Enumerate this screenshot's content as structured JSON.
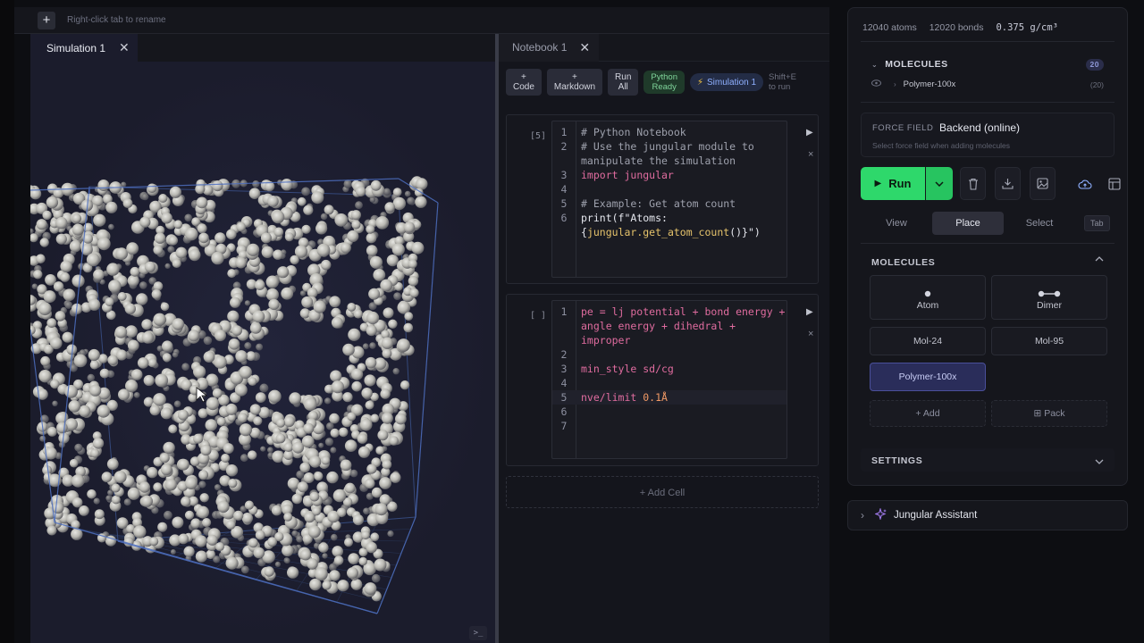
{
  "topbar": {
    "new_tab_label": "+",
    "hint": "Right-click tab to rename"
  },
  "simulation": {
    "tab_label": "Simulation 1",
    "close_glyph": "✕",
    "terminal_glyph": ">_"
  },
  "notebook": {
    "tab_label": "Notebook 1",
    "close_glyph": "✕",
    "toolbar": {
      "code_label": [
        "+",
        "Code"
      ],
      "markdown_label": [
        "+",
        "Markdown"
      ],
      "run_all_label": [
        "Run",
        "All"
      ],
      "python_ready_label": [
        "Python",
        "Ready"
      ],
      "sim_badge_icon": "⚡",
      "sim_badge_label": "Simulation 1",
      "shift_hint": [
        "Shift+E",
        "to run"
      ]
    },
    "cells": [
      {
        "count": "[5]",
        "lines": [
          {
            "n": "1",
            "tokens": [
              {
                "t": "# Python Notebook",
                "c": "comment"
              }
            ]
          },
          {
            "n": "2",
            "tokens": [
              {
                "t": "# Use the jungular module to manipulate the simulation",
                "c": "comment"
              }
            ]
          },
          {
            "n": "3",
            "tokens": [
              {
                "t": "import",
                "c": "kw"
              },
              {
                "t": " jungular",
                "c": "kw"
              }
            ]
          },
          {
            "n": "4",
            "tokens": []
          },
          {
            "n": "5",
            "tokens": [
              {
                "t": "# Example: Get atom count",
                "c": "comment"
              }
            ]
          },
          {
            "n": "6",
            "tokens": [
              {
                "t": "print",
                "c": "plain"
              },
              {
                "t": "(f\"Atoms: {",
                "c": "plain"
              },
              {
                "t": "jungular.get_atom_count",
                "c": "str"
              },
              {
                "t": "()}\")",
                "c": "plain"
              }
            ]
          }
        ]
      },
      {
        "count": "[ ]",
        "lines": [
          {
            "n": "1",
            "tokens": [
              {
                "t": "pe = lj potential + bond energy + angle energy + dihedral + improper",
                "c": "kw"
              }
            ]
          },
          {
            "n": "2",
            "tokens": []
          },
          {
            "n": "3",
            "tokens": [
              {
                "t": "min_style sd/cg",
                "c": "kw"
              }
            ]
          },
          {
            "n": "4",
            "tokens": []
          },
          {
            "n": "5",
            "tokens": [
              {
                "t": "nve/limit ",
                "c": "kw"
              },
              {
                "t": "0.1Å",
                "c": "num"
              }
            ],
            "highlight": true
          },
          {
            "n": "6",
            "tokens": []
          },
          {
            "n": "7",
            "tokens": []
          }
        ]
      }
    ],
    "run_glyph": "▶",
    "delete_glyph": "×",
    "add_cell_label": "+ Add Cell"
  },
  "right_panel": {
    "atoms": "12040 atoms",
    "bonds": "12020 bonds",
    "density": "0.375 g/cm³",
    "molecules_header": "MOLECULES",
    "molecules_count": "20",
    "molecule_item": "Polymer-100x",
    "molecule_item_count": "(20)",
    "force_field_label": "FORCE FIELD",
    "force_field_value": "Backend (online)",
    "force_field_sub": "Select force field when adding molecules",
    "run_label": "Run",
    "modes": [
      "View",
      "Place",
      "Select"
    ],
    "active_mode": "Place",
    "tab_chip": "Tab",
    "molecules_section_title": "MOLECULES",
    "cards": {
      "atom": "Atom",
      "dimer": "Dimer",
      "mol24": "Mol-24",
      "mol95": "Mol-95",
      "polymer": "Polymer-100x",
      "add": "Add",
      "pack": "Pack"
    },
    "settings_title": "SETTINGS"
  },
  "assistant": {
    "label": "Jungular Assistant"
  },
  "colors": {
    "run_green": "#2ed86b",
    "selected_card": "#2a2d5a",
    "accent_blue": "#8fb0ff"
  }
}
